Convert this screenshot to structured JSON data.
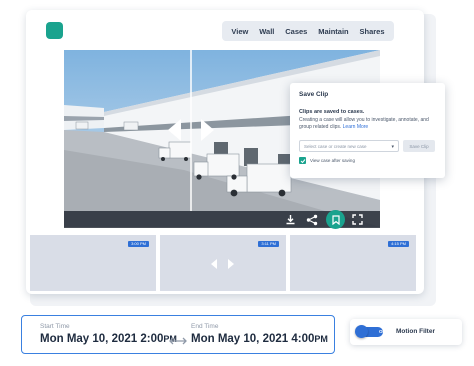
{
  "nav": {
    "items": [
      "View",
      "Wall",
      "Cases",
      "Maintain",
      "Shares"
    ]
  },
  "popup": {
    "title": "Save Clip",
    "heading": "Clips are saved to cases.",
    "description": "Creating a case will allow you to investigate, annotate, and group related clips.",
    "link": "Learn More",
    "select_placeholder": "Select case or create new case",
    "save_button": "Save Clip",
    "checkbox_label": "View case after saving",
    "checkbox_checked": true
  },
  "thumbnails": [
    {
      "time": "3:00 PM"
    },
    {
      "time": "3:11 PM"
    },
    {
      "time": "4:15 PM"
    }
  ],
  "time_range": {
    "start_label": "Start Time",
    "start_value": "Mon May 10, 2021 2:00",
    "start_suffix": "PM",
    "end_label": "End Time",
    "end_value": "Mon May 10, 2021 4:00",
    "end_suffix": "PM"
  },
  "motion_filter": {
    "toggle_label": "ON",
    "label": "Motion Filter",
    "enabled": true
  },
  "colors": {
    "accent_teal": "#1aa38e",
    "accent_blue": "#2f6fd5",
    "border_blue": "#3a80e0"
  },
  "icons": {
    "controls": [
      "download-icon",
      "share-icon",
      "bookmark-icon",
      "fullscreen-icon"
    ],
    "navigation": [
      "chevron-left-icon",
      "chevron-right-icon"
    ]
  }
}
